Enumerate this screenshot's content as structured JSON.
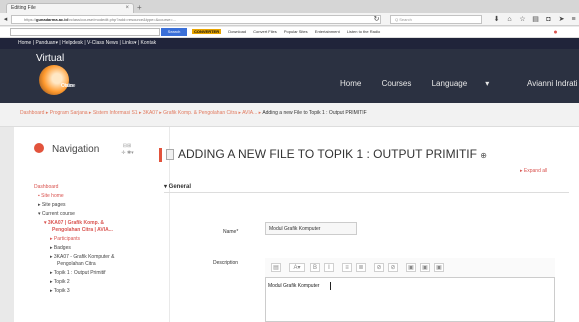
{
  "browser": {
    "tab_title": "Editing File",
    "close_glyph": "×",
    "newtab_glyph": "+",
    "url_prefix": "https://",
    "url_domain": "gunadarma.ac.id",
    "url_path": "/vclass/course/modedit.php?add=resource&type=&course=...",
    "search_placeholder": "Q Search",
    "google_search_label": "Search",
    "toolbar_items": [
      "CONVERTER",
      "Download",
      "Convert Files",
      "Popular Sites",
      "Entertainment",
      "Listen to the Radio"
    ]
  },
  "site_nav": {
    "items": [
      "Home",
      "Panduan",
      "Helpdesk",
      "V-Class News",
      "Links",
      "Kontak"
    ],
    "separator": "|",
    "dropdown_marker": "▾"
  },
  "header": {
    "logo_title": "Virtual",
    "logo_sub1": "Class",
    "logo_sub2": "Online",
    "nav": [
      "Home",
      "Courses",
      "Language",
      "Avianni Indrati"
    ],
    "dropdown_marker": "▾"
  },
  "breadcrumb": {
    "text": "Dashboard ▸ Program Sarjana ▸ Sistem Informasi S1 ▸ 3KA07 ▸ Grafik Komp. & Pengolahan Citra ▸ AVIA... ▸",
    "current": "Adding a new File to Topik 1 : Output PRIMITIF"
  },
  "sidebar": {
    "title": "Navigation",
    "controls": "  ⊟⊞\n ✛ ✱▾",
    "items": [
      {
        "text": "Dashboard",
        "level": 0,
        "color": "red"
      },
      {
        "text": "▪ Site home",
        "level": 1,
        "color": "red"
      },
      {
        "text": "▸ Site pages",
        "level": 1,
        "color": "dark"
      },
      {
        "text": "▾ Current course",
        "level": 1,
        "color": "dark"
      },
      {
        "text": "▾ 3KA07 | Grafik Komp. &",
        "level": 2,
        "color": "bold"
      },
      {
        "text": "Pengolahan Citra | AVIA...",
        "level": 3,
        "color": "bold"
      },
      {
        "text": "▸ Participants",
        "level": 3,
        "color": "red"
      },
      {
        "text": "▸ Badges",
        "level": 3,
        "color": "dark"
      },
      {
        "text": "▸ 3KA07 - Grafik Komputer &",
        "level": 3,
        "color": "dark"
      },
      {
        "text": "Pengolahan Citra",
        "level": 4,
        "color": "dark"
      },
      {
        "text": "▸ Topik 1 : Output Primitif",
        "level": 3,
        "color": "dark"
      },
      {
        "text": "▸ Topik 2",
        "level": 3,
        "color": "dark"
      },
      {
        "text": "▸ Topik 3",
        "level": 3,
        "color": "dark"
      }
    ]
  },
  "main": {
    "title": "ADDING A NEW FILE TO TOPIK 1 : OUTPUT PRIMITIF",
    "help_glyph": "⊕",
    "expand_all": "▸ Expand all",
    "section": "▾ General",
    "name_label": "Name*",
    "name_value": "Modul Grafik Komputer",
    "description_label": "Description",
    "editor_text": "Modul Grafik Komputer",
    "editor_tools": [
      "▤",
      "A▾",
      "B",
      "I",
      "≡",
      "≣",
      "⊘",
      "⊘",
      "▣",
      "▣",
      "▣"
    ]
  },
  "colors": {
    "accent": "#e2533c",
    "header_bg": "#2b3141",
    "link": "#d9534f"
  }
}
